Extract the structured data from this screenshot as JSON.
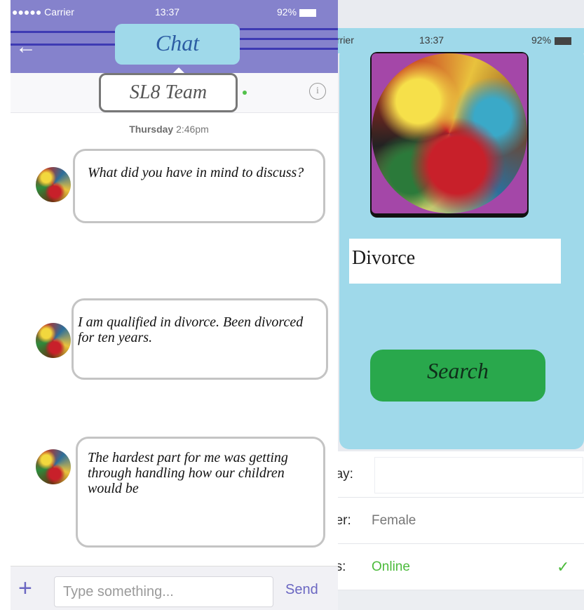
{
  "right_screen": {
    "status": {
      "carrier": "rrier",
      "time": "13:37",
      "battery": "92%"
    },
    "search": {
      "value": "Divorce",
      "button_label": "Search"
    },
    "profile": {
      "birthday_label": "day:",
      "gender_label": "der:",
      "gender_value": "Female",
      "status_label": "us:",
      "status_value": "Online"
    },
    "colors": {
      "panel": "#9fd9ea",
      "search_button": "#29a84c",
      "online": "#4cbb3c"
    }
  },
  "left_screen": {
    "status": {
      "carrier": "●●●●● Carrier",
      "time": "13:37",
      "battery": "92%"
    },
    "header": {
      "back_icon": "back-arrow-icon",
      "title": "Chat"
    },
    "contact": {
      "name": "SL8 Team",
      "info_icon": "info-icon"
    },
    "date": {
      "day": "Thursday",
      "time": "2:46pm"
    },
    "messages": [
      {
        "text": "What did you have in mind to discuss?"
      },
      {
        "text": "I am qualified in divorce. Been divorced for ten years."
      },
      {
        "text": "The hardest part for me was getting through handling how our children would be"
      }
    ],
    "composer": {
      "placeholder": "Type something...",
      "send_label": "Send",
      "add_icon": "plus-icon"
    },
    "colors": {
      "header": "#8582cc",
      "accent": "#6b67c2",
      "title_badge": "#9fd9ea"
    }
  }
}
